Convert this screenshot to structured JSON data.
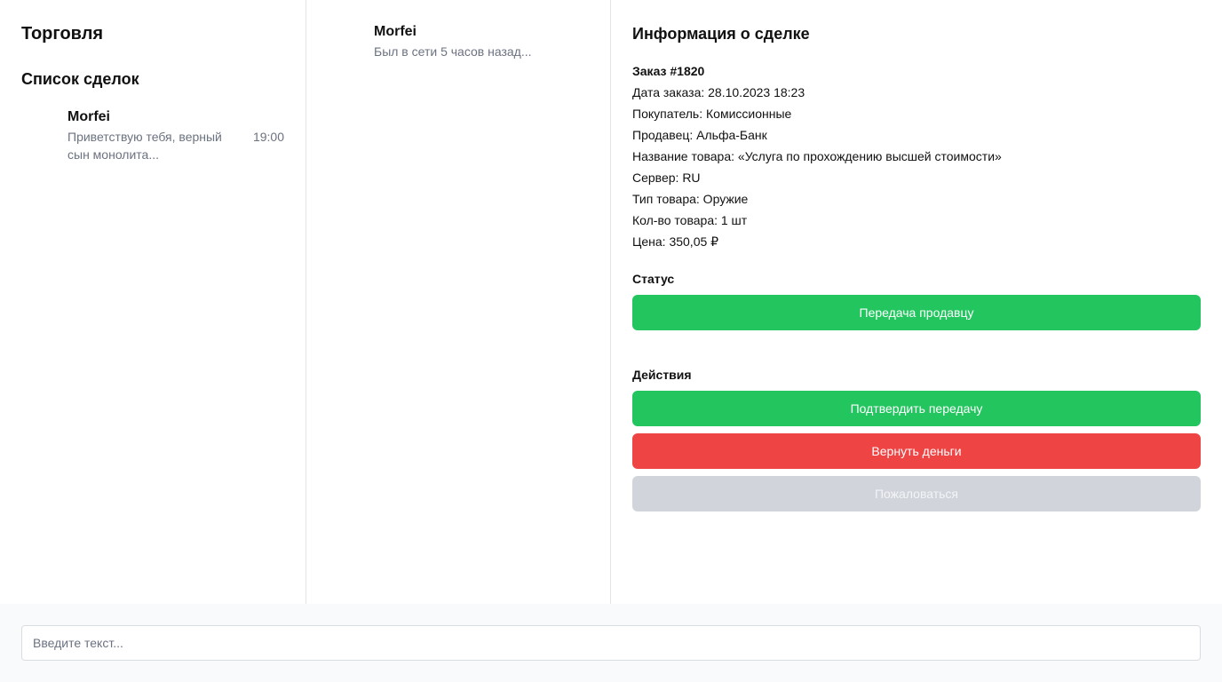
{
  "sidebar": {
    "app_title": "Торговля",
    "list_title": "Список сделок",
    "deals": [
      {
        "name": "Morfei",
        "preview": "Приветствую тебя, верный сын монолита...",
        "time": "19:00"
      }
    ]
  },
  "chat": {
    "name": "Morfei",
    "status": "Был в сети 5 часов назад..."
  },
  "info": {
    "title": "Информация о сделке",
    "order": "Заказ #1820",
    "date": "Дата заказа: 28.10.2023 18:23",
    "buyer": "Покупатель: Комиссионные",
    "seller": "Продавец: Альфа-Банк",
    "product_name": "Название товара: «Услуга по прохождению высшей стоимости»",
    "server": "Сервер: RU",
    "product_type": "Тип товара: Оружие",
    "quantity": "Кол-во товара: 1 шт",
    "price": "Цена: 350,05 ₽",
    "status_label": "Статус",
    "status_value": "Передача продавцу",
    "actions_label": "Действия",
    "actions": {
      "confirm": "Подтвердить передачу",
      "refund": "Вернуть деньги",
      "complain": "Пожаловаться"
    }
  },
  "composer": {
    "placeholder": "Введите текст..."
  },
  "colors": {
    "green": "#22c55e",
    "red": "#ef4444",
    "gray": "#d1d5db"
  }
}
